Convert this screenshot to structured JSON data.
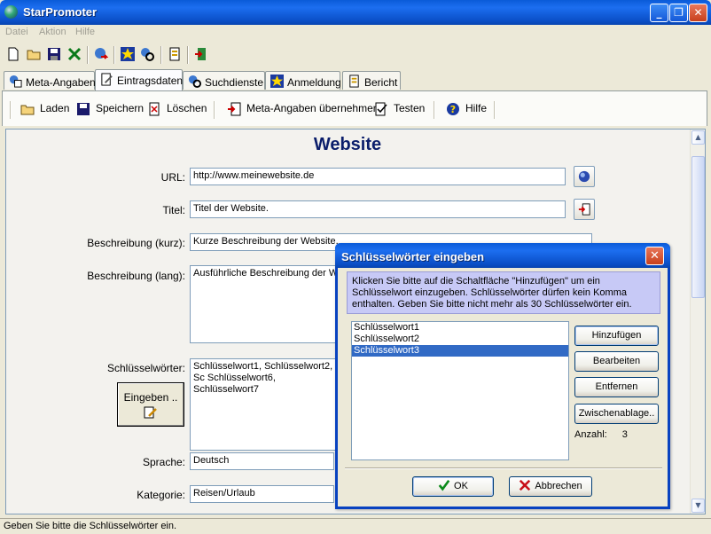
{
  "window": {
    "title": "StarPromoter"
  },
  "menu": [
    "Datei",
    "Aktion",
    "Hilfe"
  ],
  "tabs": [
    {
      "label": "Meta-Angaben"
    },
    {
      "label": "Eintragsdaten"
    },
    {
      "label": "Suchdienste"
    },
    {
      "label": "Anmeldung"
    },
    {
      "label": "Bericht"
    }
  ],
  "toolbar2": {
    "laden": "Laden",
    "speichern": "Speichern",
    "loeschen": "Löschen",
    "meta": "Meta-Angaben übernehmen",
    "testen": "Testen",
    "hilfe": "Hilfe"
  },
  "form": {
    "heading": "Website",
    "url_label": "URL:",
    "url_value": "http://www.meinewebsite.de",
    "titel_label": "Titel:",
    "titel_value": "Titel der Website.",
    "kurz_label": "Beschreibung (kurz):",
    "kurz_value": "Kurze Beschreibung der Website.",
    "lang_label": "Beschreibung (lang):",
    "lang_value": "Ausführliche Beschreibung der We",
    "kw_label": "Schlüsselwörter:",
    "kw_value": "Schlüsselwort1, Schlüsselwort2, Sc Schlüsselwort6, Schlüsselwort7",
    "eingeben_button": "Eingeben ..",
    "sprache_label": "Sprache:",
    "sprache_value": "Deutsch",
    "kategorie_label": "Kategorie:",
    "kategorie_value": "Reisen/Urlaub"
  },
  "status": "Geben Sie bitte die Schlüsselwörter ein.",
  "dialog": {
    "title": "Schlüsselwörter eingeben",
    "info": "Klicken Sie bitte auf die Schaltfläche \"Hinzufügen\" um ein Schlüsselwort einzugeben. Schlüsselwörter dürfen kein Komma enthalten. Geben Sie bitte nicht mehr als 30 Schlüsselwörter ein.",
    "keywords": [
      "Schlüsselwort1",
      "Schlüsselwort2",
      "Schlüsselwort3"
    ],
    "selected_index": 2,
    "buttons": {
      "hinzufuegen": "Hinzufügen",
      "bearbeiten": "Bearbeiten",
      "entfernen": "Entfernen",
      "zwischenablage": "Zwischenablage..",
      "ok": "OK",
      "abbrechen": "Abbrechen"
    },
    "count_label": "Anzahl:",
    "count_value": "3"
  }
}
